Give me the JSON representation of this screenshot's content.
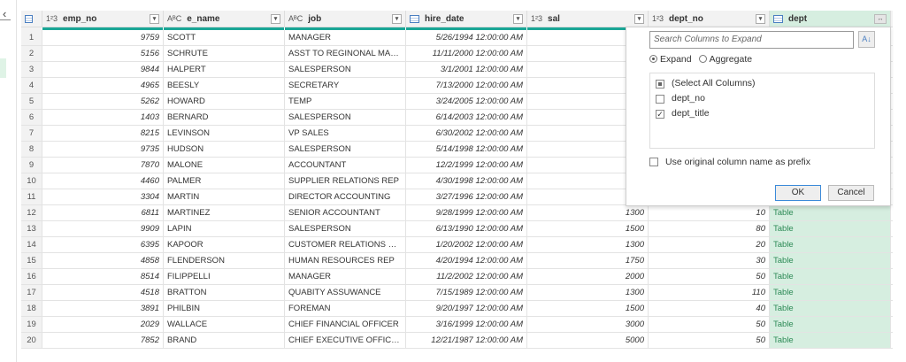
{
  "sidebar": {
    "collapse_icon": "chevron-left"
  },
  "columns": [
    {
      "name": "emp_no",
      "type": "1²3"
    },
    {
      "name": "e_name",
      "type": "AᴮC"
    },
    {
      "name": "job",
      "type": "AᴮC"
    },
    {
      "name": "hire_date",
      "type": "datetime"
    },
    {
      "name": "sal",
      "type": "1²3"
    },
    {
      "name": "dept_no",
      "type": "1²3"
    },
    {
      "name": "dept",
      "type": "table"
    }
  ],
  "rows": [
    [
      "1",
      "9759",
      "SCOTT",
      "MANAGER",
      "5/26/1994 12:00:00 AM",
      "",
      "",
      ""
    ],
    [
      "2",
      "5156",
      "SCHRUTE",
      "ASST TO REGINONAL MANAG...",
      "11/11/2000 12:00:00 AM",
      "",
      "",
      ""
    ],
    [
      "3",
      "9844",
      "HALPERT",
      "SALESPERSON",
      "3/1/2001 12:00:00 AM",
      "",
      "",
      ""
    ],
    [
      "4",
      "4965",
      "BEESLY",
      "SECRETARY",
      "7/13/2000 12:00:00 AM",
      "",
      "",
      ""
    ],
    [
      "5",
      "5262",
      "HOWARD",
      "TEMP",
      "3/24/2005 12:00:00 AM",
      "",
      "",
      ""
    ],
    [
      "6",
      "1403",
      "BERNARD",
      "SALESPERSON",
      "6/14/2003 12:00:00 AM",
      "",
      "",
      ""
    ],
    [
      "7",
      "8215",
      "LEVINSON",
      "VP SALES",
      "6/30/2002 12:00:00 AM",
      "",
      "",
      ""
    ],
    [
      "8",
      "9735",
      "HUDSON",
      "SALESPERSON",
      "5/14/1998 12:00:00 AM",
      "",
      "",
      ""
    ],
    [
      "9",
      "7870",
      "MALONE",
      "ACCOUNTANT",
      "12/2/1999 12:00:00 AM",
      "",
      "",
      ""
    ],
    [
      "10",
      "4460",
      "PALMER",
      "SUPPLIER RELATIONS REP",
      "4/30/1998 12:00:00 AM",
      "",
      "",
      ""
    ],
    [
      "11",
      "3304",
      "MARTIN",
      "DIRECTOR ACCOUNTING",
      "3/27/1996 12:00:00 AM",
      "",
      "",
      ""
    ],
    [
      "12",
      "6811",
      "MARTINEZ",
      "SENIOR ACCOUNTANT",
      "9/28/1999 12:00:00 AM",
      "1300",
      "10",
      "Table"
    ],
    [
      "13",
      "9909",
      "LAPIN",
      "SALESPERSON",
      "6/13/1990 12:00:00 AM",
      "1500",
      "80",
      "Table"
    ],
    [
      "14",
      "6395",
      "KAPOOR",
      "CUSTOMER RELATIONS REP",
      "1/20/2002 12:00:00 AM",
      "1300",
      "20",
      "Table"
    ],
    [
      "15",
      "4858",
      "FLENDERSON",
      "HUMAN RESOURCES REP",
      "4/20/1994 12:00:00 AM",
      "1750",
      "30",
      "Table"
    ],
    [
      "16",
      "8514",
      "FILIPPELLI",
      "MANAGER",
      "11/2/2002 12:00:00 AM",
      "2000",
      "50",
      "Table"
    ],
    [
      "17",
      "4518",
      "BRATTON",
      "QUABITY ASSUWANCE",
      "7/15/1989 12:00:00 AM",
      "1300",
      "110",
      "Table"
    ],
    [
      "18",
      "3891",
      "PHILBIN",
      "FOREMAN",
      "9/20/1997 12:00:00 AM",
      "1500",
      "40",
      "Table"
    ],
    [
      "19",
      "2029",
      "WALLACE",
      "CHIEF FINANCIAL OFFICER",
      "3/16/1999 12:00:00 AM",
      "3000",
      "50",
      "Table"
    ],
    [
      "20",
      "7852",
      "BRAND",
      "CHIEF EXECUTIVE OFFICER",
      "12/21/1987 12:00:00 AM",
      "5000",
      "50",
      "Table"
    ]
  ],
  "expand_popup": {
    "search_placeholder": "Search Columns to Expand",
    "sort_icon": "sort-az",
    "mode_expand": "Expand",
    "mode_aggregate": "Aggregate",
    "selected_mode": "Expand",
    "items": [
      {
        "label": "(Select All Columns)",
        "state": "partial"
      },
      {
        "label": "dept_no",
        "state": "unchecked"
      },
      {
        "label": "dept_title",
        "state": "checked"
      }
    ],
    "prefix_label": "Use original column name as prefix",
    "prefix_checked": false,
    "ok": "OK",
    "cancel": "Cancel"
  },
  "colors": {
    "accent": "#1aa696",
    "table_col": "#d6eee0",
    "table_text": "#2e8b57"
  }
}
